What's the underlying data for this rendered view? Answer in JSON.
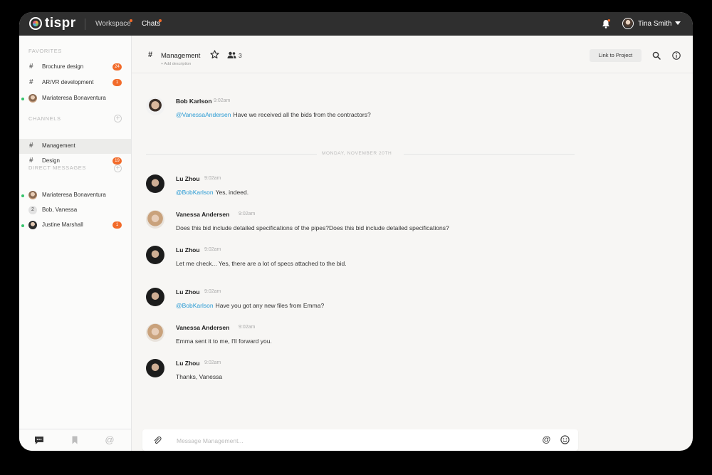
{
  "app": {
    "logo_text": "tispr",
    "nav": [
      {
        "label": "Workspace"
      },
      {
        "label": "Chats"
      }
    ],
    "user_name": "Tina Smith"
  },
  "sidebar": {
    "favorites_title": "FAVORITES",
    "channels_title": "CHANNELS",
    "dm_title": "DIRECT MESSAGES",
    "favorites": [
      {
        "label": "Brochure design",
        "badge": "24"
      },
      {
        "label": "AR/VR development",
        "badge": "1"
      },
      {
        "label": "Mariateresa Bonaventura"
      }
    ],
    "channels": [
      {
        "label": "Management"
      },
      {
        "label": "Design",
        "badge": "19"
      }
    ],
    "dms": [
      {
        "label": "Mariateresa Bonaventura"
      },
      {
        "label": "Bob, Vanessa",
        "count": "2"
      },
      {
        "label": "Justine Marshall",
        "badge": "1"
      }
    ]
  },
  "channel": {
    "name": "Management",
    "description": "+ Add description",
    "members_count": "3",
    "link_button": "Link to Project"
  },
  "day_separator": "MONDAY, NOVEMBER 20TH",
  "messages": [
    {
      "author": "Bob Karlson",
      "time": "9:02am",
      "mention": "@VanessaAndersen",
      "text": "Have we received all the bids from the contractors?"
    },
    {
      "author": "Lu Zhou",
      "time": "9:02am",
      "mention": "@BobKarlson",
      "text": "Yes, indeed."
    },
    {
      "author": "Vanessa Andersen",
      "time": "9:02am",
      "text": "Does this bid include detailed specifications of the pipes?Does this bid include detailed specifications?"
    },
    {
      "author": "Lu Zhou",
      "time": "9:02am",
      "text": "Let me check... Yes, there are a lot of specs attached to the bid."
    },
    {
      "author": "Lu Zhou",
      "time": "9:02am",
      "mention": "@BobKarlson",
      "text": "Have you got any new files from Emma?"
    },
    {
      "author": "Vanessa Andersen",
      "time": "9:02am",
      "text": "Emma sent it to me, I'll forward you."
    },
    {
      "author": "Lu Zhou",
      "time": "9:02am",
      "text": "Thanks, Vanessa"
    }
  ],
  "composer": {
    "placeholder": "Message Management..."
  },
  "colors": {
    "accent": "#f26b2a",
    "mention": "#2a9bd4",
    "online": "#35c36b",
    "topbar": "#2f2f2f"
  }
}
